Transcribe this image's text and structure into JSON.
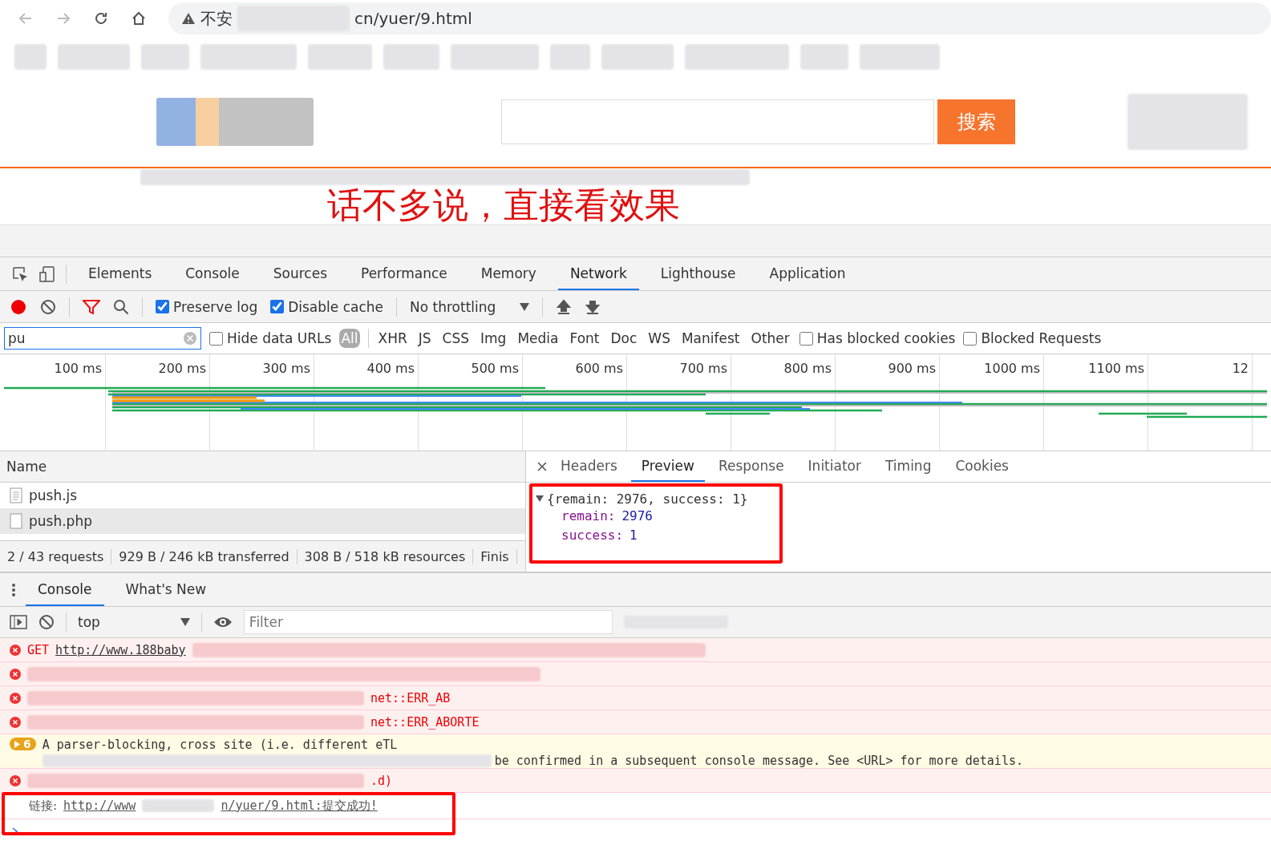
{
  "browser": {
    "url_prefix": "不安",
    "url_suffix": "cn/yuer/9.html"
  },
  "page": {
    "search_button": "搜索",
    "headline": "话不多说，直接看效果"
  },
  "devtools": {
    "tabs": [
      {
        "label": "Elements",
        "selected": false
      },
      {
        "label": "Console",
        "selected": false
      },
      {
        "label": "Sources",
        "selected": false
      },
      {
        "label": "Performance",
        "selected": false
      },
      {
        "label": "Memory",
        "selected": false
      },
      {
        "label": "Network",
        "selected": true
      },
      {
        "label": "Lighthouse",
        "selected": false
      },
      {
        "label": "Application",
        "selected": false
      }
    ],
    "toolbar": {
      "recording": true,
      "preserve_log": {
        "label": "Preserve log",
        "checked": true
      },
      "disable_cache": {
        "label": "Disable cache",
        "checked": true
      },
      "throttling": "No throttling"
    },
    "filter": {
      "value": "pu",
      "hide_data_urls": {
        "label": "Hide data URLs",
        "checked": false
      },
      "types": [
        {
          "label": "All",
          "selected": true
        },
        {
          "label": "XHR",
          "selected": false
        },
        {
          "label": "JS",
          "selected": false
        },
        {
          "label": "CSS",
          "selected": false
        },
        {
          "label": "Img",
          "selected": false
        },
        {
          "label": "Media",
          "selected": false
        },
        {
          "label": "Font",
          "selected": false
        },
        {
          "label": "Doc",
          "selected": false
        },
        {
          "label": "WS",
          "selected": false
        },
        {
          "label": "Manifest",
          "selected": false
        },
        {
          "label": "Other",
          "selected": false
        }
      ],
      "has_blocked_cookies": {
        "label": "Has blocked cookies",
        "checked": false
      },
      "blocked_requests": {
        "label": "Blocked Requests",
        "checked": false
      }
    },
    "timeline": {
      "ticks": [
        "100 ms",
        "200 ms",
        "300 ms",
        "400 ms",
        "500 ms",
        "600 ms",
        "700 ms",
        "800 ms",
        "900 ms",
        "1000 ms",
        "1100 ms",
        "12"
      ]
    },
    "requests": {
      "header": "Name",
      "rows": [
        {
          "name": "push.js",
          "kind": "script",
          "selected": false
        },
        {
          "name": "push.php",
          "kind": "blank",
          "selected": true
        }
      ]
    },
    "summary": [
      "2 / 43 requests",
      "929 B / 246 kB transferred",
      "308 B / 518 kB resources",
      "Finis"
    ],
    "detail": {
      "tabs": [
        {
          "label": "Headers",
          "selected": false
        },
        {
          "label": "Preview",
          "selected": true
        },
        {
          "label": "Response",
          "selected": false
        },
        {
          "label": "Initiator",
          "selected": false
        },
        {
          "label": "Timing",
          "selected": false
        },
        {
          "label": "Cookies",
          "selected": false
        }
      ],
      "preview": {
        "summary": "{remain: 2976, success: 1}",
        "expanded": true,
        "fields": [
          {
            "key": "remain:",
            "value": "2976"
          },
          {
            "key": "success:",
            "value": "1"
          }
        ]
      }
    }
  },
  "drawer": {
    "tabs": [
      {
        "label": "Console",
        "selected": true
      },
      {
        "label": "What's New",
        "selected": false
      }
    ],
    "context": "top",
    "filter_placeholder": "Filter",
    "messages": [
      {
        "kind": "error",
        "method": "GET",
        "link": "http://www.188baby"
      },
      {
        "kind": "error"
      },
      {
        "kind": "error",
        "tail": "net::ERR_AB"
      },
      {
        "kind": "error",
        "tail": "net::ERR_ABORTE"
      },
      {
        "kind": "warning",
        "count": "6",
        "line1": "A parser-blocking, cross site (i.e. different eTL",
        "line2": "be confirmed in a subsequent console message. See <URL> for more details."
      },
      {
        "kind": "error",
        "tail": ".d)"
      },
      {
        "kind": "log",
        "prefix": "链接:",
        "link_start": "http://www",
        "link_end": "n/yuer/9.html:提交成功!"
      }
    ]
  }
}
